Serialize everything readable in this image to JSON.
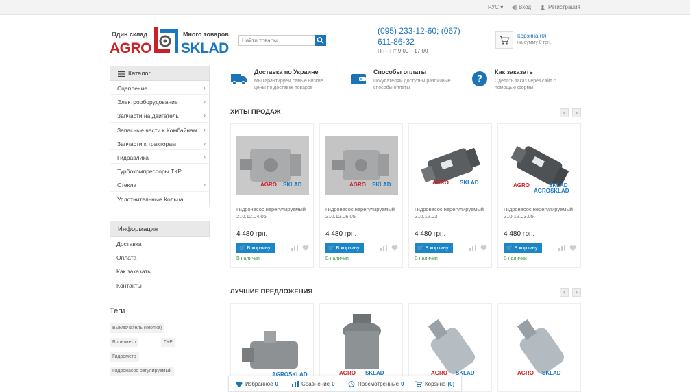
{
  "topbar": {
    "lang": "РУС",
    "login": "Вход",
    "register": "Регистрация"
  },
  "header": {
    "slogan_left": "Один склад",
    "slogan_right": "Много товаров",
    "logo_agro": "AGRO",
    "logo_sklad": "SKLAD",
    "search_placeholder": "Найти товары",
    "phone": "(095) 233-12-60; (067) 611-86-32",
    "hours": "Пн—Пт 9:00—17:00",
    "cart_title": "Корзина (0)",
    "cart_sub": "на сумму 0 грн."
  },
  "sidebar": {
    "catalog_label": "Каталог",
    "categories": [
      {
        "label": "Сцепление",
        "has_children": true
      },
      {
        "label": "Электрооборудование",
        "has_children": true
      },
      {
        "label": "Запчасти на двигатель",
        "has_children": true
      },
      {
        "label": "Запасные части к Комбайнам",
        "has_children": true
      },
      {
        "label": "Запчасти к тракторам",
        "has_children": true
      },
      {
        "label": "Гидравлика",
        "has_children": true
      },
      {
        "label": "Турбокомпрессоры ТКР",
        "has_children": false
      },
      {
        "label": "Стекла",
        "has_children": true
      },
      {
        "label": "Уплотнительные Кольца",
        "has_children": false
      }
    ],
    "info_label": "Информация",
    "info_items": [
      "Доставка",
      "Оплата",
      "Как заказать",
      "Контакты"
    ],
    "tags_title": "Теги",
    "tags": [
      "Выключатель (кнопка)",
      "Вольтметр",
      "ГУР",
      "Гидрометр",
      "Гидронасос регулируемый"
    ]
  },
  "features": [
    {
      "title": "Доставка по Украине",
      "desc": "Мы гарантируем самые низкие цены по доставке товаров",
      "icon": "truck-icon"
    },
    {
      "title": "Способы оплаты",
      "desc": "Покупателям доступны различные способы оплаты",
      "icon": "wallet-icon"
    },
    {
      "title": "Как заказать",
      "desc": "Сделать заказ через сайт с помощью формы",
      "icon": "question-icon"
    }
  ],
  "sections": {
    "bestsellers": "ХИТЫ ПРОДАЖ",
    "best_offers": "ЛУЧШИЕ ПРЕДЛОЖЕНИЯ"
  },
  "products": [
    {
      "name": "Гидронасос нерегулируемый 210.12.04.05",
      "price": "4 480 грн.",
      "buy": "В корзину",
      "stock": "В наличии"
    },
    {
      "name": "Гидронасос нерегулируемый 210.12.06.05",
      "price": "4 480 грн.",
      "buy": "В корзину",
      "stock": "В наличии"
    },
    {
      "name": "Гидронасос нерегулируемый 210.12.03",
      "price": "4 480 грн.",
      "buy": "В корзину",
      "stock": "В наличии"
    },
    {
      "name": "Гидронасос нерегулируемый 210.12.03.05",
      "price": "4 480 грн.",
      "buy": "В корзину",
      "stock": "В наличии"
    }
  ],
  "bottombar": {
    "favorites": "Избранное",
    "favorites_count": "0",
    "compare": "Сравнение",
    "compare_count": "0",
    "viewed": "Просмотренные",
    "viewed_count": "0",
    "cart": "Корзина",
    "cart_count": "(0)"
  },
  "colors": {
    "brand_blue": "#1d73b8",
    "brand_red": "#c92128",
    "button_blue": "#1d86c8"
  }
}
